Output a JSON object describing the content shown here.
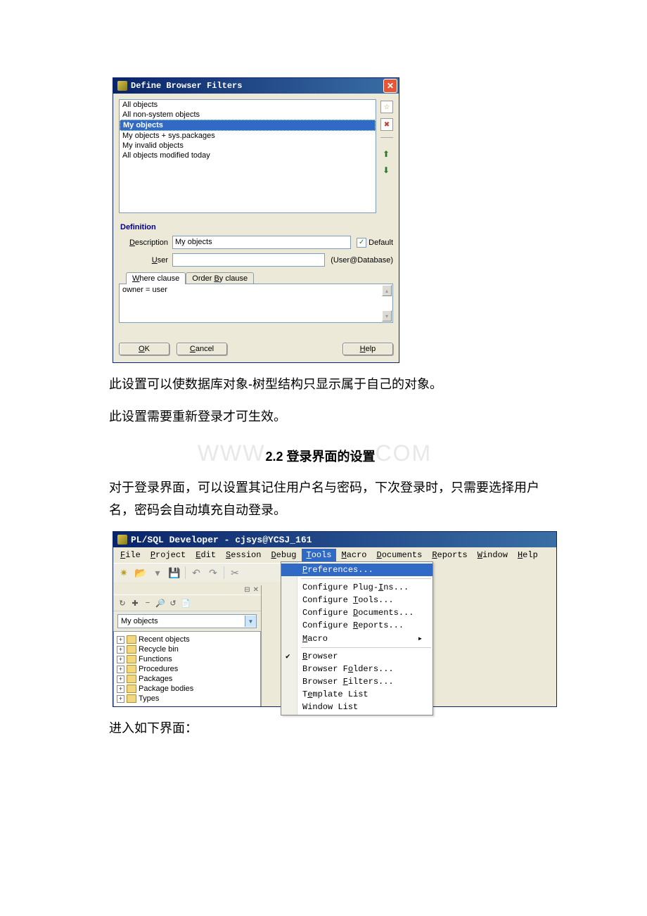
{
  "dialog": {
    "title": "Define Browser Filters",
    "list": [
      "All objects",
      "All non-system objects",
      "My objects",
      "My objects + sys.packages",
      "My invalid objects",
      "All objects modified today"
    ],
    "selected_index": 2,
    "side_icons": [
      "new-icon",
      "delete-icon"
    ],
    "definition_label": "Definition",
    "description_label": "Description",
    "description_value": "My objects",
    "default_label": "Default",
    "default_checked": true,
    "user_label": "User",
    "user_value": "",
    "user_hint": "(User@Database)",
    "tab_where": "Where clause",
    "tab_order": "Order By clause",
    "where_value": "owner = user",
    "ok": "OK",
    "cancel": "Cancel",
    "help": "Help"
  },
  "text": {
    "p1": "此设置可以使数据库对象-树型结构只显示属于自己的对象。",
    "p2": "此设置需要重新登录才可生效。",
    "section_no": "2.2",
    "section_title": "登录界面的设置",
    "p3": "对于登录界面，可以设置其记住用户名与密码，下次登录时，只需要选择用户名，密码会自动填充自动登录。",
    "p4": "进入如下界面："
  },
  "watermark": {
    "left": "WWW",
    "right": "COM"
  },
  "app": {
    "title": "PL/SQL Developer - cjsys@YCSJ_161",
    "menu": [
      "File",
      "Project",
      "Edit",
      "Session",
      "Debug",
      "Tools",
      "Macro",
      "Documents",
      "Reports",
      "Window",
      "Help"
    ],
    "menu_active": 5,
    "combo_value": "My objects",
    "tree": [
      "Recent objects",
      "Recycle bin",
      "Functions",
      "Procedures",
      "Packages",
      "Package bodies",
      "Types"
    ],
    "tools_menu": [
      {
        "label": "Preferences...",
        "hl": true
      },
      {
        "sep": true
      },
      {
        "label": "Configure Plug-Ins..."
      },
      {
        "label": "Configure Tools..."
      },
      {
        "label": "Configure Documents..."
      },
      {
        "label": "Configure Reports..."
      },
      {
        "label": "Macro",
        "arrow": true
      },
      {
        "sep": true
      },
      {
        "label": "Browser",
        "check": true
      },
      {
        "label": "Browser Folders..."
      },
      {
        "label": "Browser Filters..."
      },
      {
        "label": "Template List"
      },
      {
        "label": "Window List"
      }
    ]
  }
}
